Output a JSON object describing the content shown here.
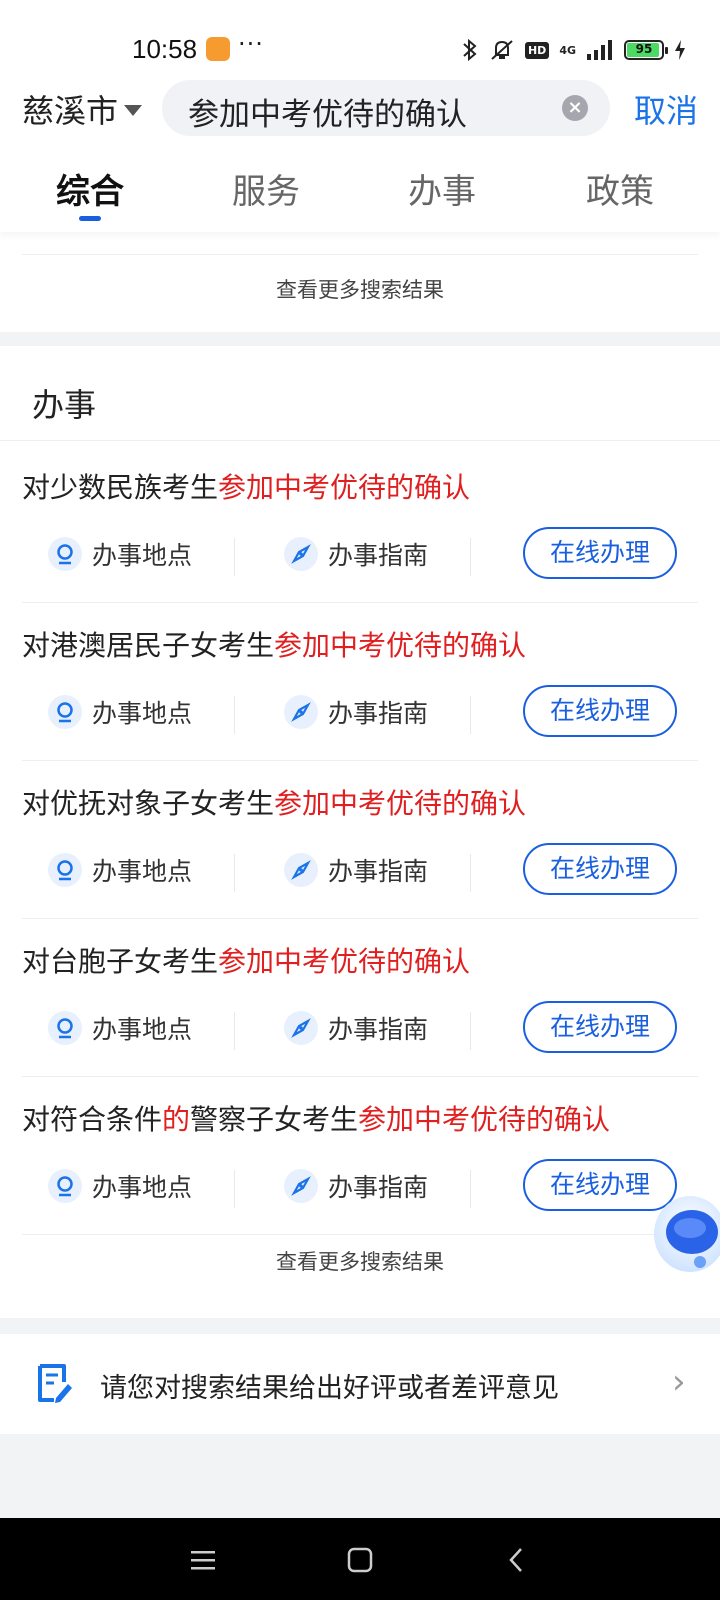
{
  "status_bar": {
    "time": "10:58",
    "network": "4G",
    "hd": "HD",
    "battery": "95",
    "battery_level_percent": 95,
    "icons": [
      "bluetooth-icon",
      "mute-icon",
      "hd-icon",
      "signal-icon",
      "battery-icon",
      "charging-icon"
    ]
  },
  "search": {
    "city": "慈溪市",
    "query": "参加中考优待的确认",
    "cancel": "取消"
  },
  "tabs": [
    {
      "label": "综合",
      "active": true
    },
    {
      "label": "服务",
      "active": false
    },
    {
      "label": "办事",
      "active": false
    },
    {
      "label": "政策",
      "active": false
    }
  ],
  "top_card": {
    "more": "查看更多搜索结果"
  },
  "affairs": {
    "title": "办事",
    "location_label": "办事地点",
    "guide_label": "办事指南",
    "online_label": "在线办理",
    "items": [
      {
        "prefix": "对少数民族考生",
        "mid_hl": "",
        "mid": "",
        "highlight": "参加中考优待的确认"
      },
      {
        "prefix": "对港澳居民子女考生",
        "mid_hl": "",
        "mid": "",
        "highlight": "参加中考优待的确认"
      },
      {
        "prefix": "对优抚对象子女考生",
        "mid_hl": "",
        "mid": "",
        "highlight": "参加中考优待的确认"
      },
      {
        "prefix": "对台胞子女考生",
        "mid_hl": "",
        "mid": "",
        "highlight": "参加中考优待的确认"
      },
      {
        "prefix": "对符合条件",
        "mid_hl": "的",
        "mid": "警察子女考生",
        "highlight": "参加中考优待的确认"
      }
    ],
    "more": "查看更多搜索结果"
  },
  "feedback": {
    "text": "请您对搜索结果给出好评或者差评意见"
  },
  "colors": {
    "accent": "#1a5fe0",
    "highlight": "#e02020",
    "link": "#1a73e8"
  }
}
